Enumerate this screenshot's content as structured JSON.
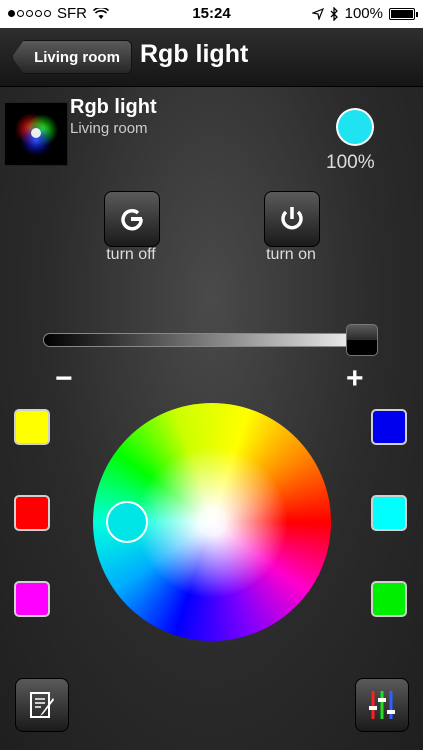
{
  "status_bar": {
    "carrier": "SFR",
    "time": "15:24",
    "battery": "100%",
    "battery_level": 1.0
  },
  "nav": {
    "back_label": "Living room",
    "title": "Rgb light"
  },
  "device": {
    "name": "Rgb light",
    "room": "Living room",
    "current_color": "#1fe3f0",
    "brightness": "100%"
  },
  "actions": {
    "turn_off": "turn off",
    "turn_on": "turn on"
  },
  "slider": {
    "value": 1.0,
    "minus_label": "−",
    "plus_label": "+"
  },
  "presets": {
    "left": [
      "#ffff00",
      "#ff0000",
      "#ff00ff"
    ],
    "right": [
      "#0000ee",
      "#00ffff",
      "#00ee00"
    ]
  },
  "wheel": {
    "selected_color": "#00e5e5"
  }
}
